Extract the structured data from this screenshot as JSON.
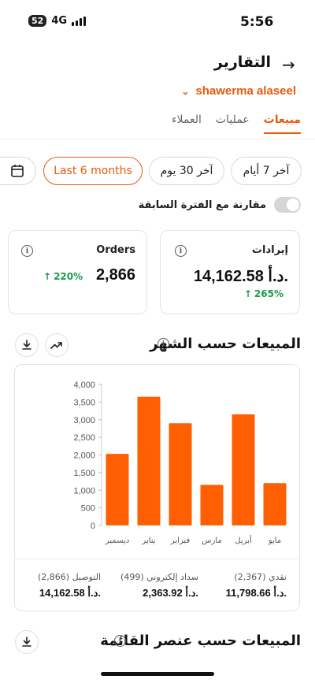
{
  "status_bar": {
    "time": "5:56",
    "battery_badge": "52",
    "network": "4G"
  },
  "header": {
    "title": "التقارير",
    "back_icon": "arrow-right-icon",
    "store_name": "shawerma alaseel"
  },
  "tabs": [
    {
      "label": "مبيعات",
      "active": true
    },
    {
      "label": "عمليات",
      "active": false
    },
    {
      "label": "العملاء",
      "active": false
    }
  ],
  "periods": [
    {
      "label": "آخر 7 أيام",
      "active": false
    },
    {
      "label": "آخر 30 يوم",
      "active": false
    },
    {
      "label": "Last 6 months",
      "active": true
    }
  ],
  "compare_label": "مقارنة مع الفترة السابقة",
  "kpis": {
    "revenue": {
      "label": "إيرادات",
      "value": "14,162.58 د.أ.",
      "delta": "265%"
    },
    "orders": {
      "label": "Orders",
      "value": "2,866",
      "delta": "220%"
    }
  },
  "sales_by_month": {
    "title": "المبيعات حسب الشهر",
    "summary": [
      {
        "label": "نقدي (2,367)",
        "value": "11,798.66 د.أ."
      },
      {
        "label": "سداد إلكتروني (499)",
        "value": "2,363.92 د.أ."
      },
      {
        "label": "التوصيل (2,866)",
        "value": "14,162.58 د.أ."
      }
    ]
  },
  "chart_data": {
    "type": "bar",
    "categories": [
      "مايو",
      "أبريل",
      "مارس",
      "فبراير",
      "يناير",
      "ديسمبر"
    ],
    "values": [
      1200,
      3150,
      1150,
      2900,
      3650,
      2030
    ],
    "ylim": [
      0,
      4000
    ],
    "yticks": [
      "0",
      "500",
      "1,000",
      "1,500",
      "2,000",
      "2,500",
      "3,000",
      "3,500",
      "4,000"
    ],
    "bar_color": "#ff5f00",
    "grid": false,
    "title": "",
    "xlabel": "",
    "ylabel": ""
  },
  "next_section": {
    "title": "المبيعات حسب عنصر القائمة"
  },
  "colors": {
    "accent": "#ea5a0c",
    "positive": "#1a9a4c"
  }
}
